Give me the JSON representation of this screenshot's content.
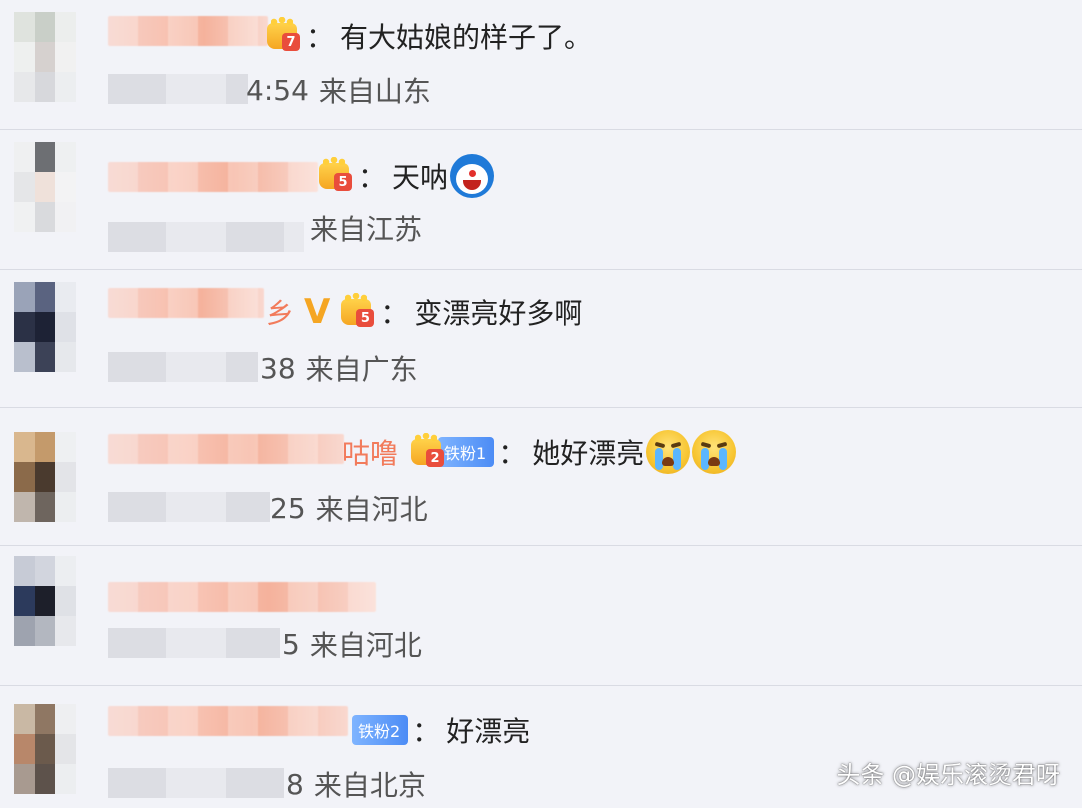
{
  "comments": [
    {
      "name_tail": "",
      "badges": [
        "level-7"
      ],
      "text": "有大姑娘的样子了。",
      "time_tail": "4:54",
      "location": "来自山东",
      "emojis": []
    },
    {
      "name_tail": "",
      "badges": [
        "level-5"
      ],
      "text": "天呐",
      "time_tail": "",
      "location": "来自江苏",
      "emojis": [
        "doraemon-shocked"
      ]
    },
    {
      "name_tail": "乡",
      "badges": [
        "v-verified",
        "level-5"
      ],
      "text": "变漂亮好多啊",
      "time_tail": "38",
      "location": "来自广东",
      "emojis": []
    },
    {
      "name_tail": "咕噜",
      "badges": [
        "level-2",
        "fan-1"
      ],
      "fan_label": "铁粉1",
      "text": "她好漂亮",
      "time_tail": "25",
      "location": "来自河北",
      "emojis": [
        "crying-face",
        "crying-face"
      ]
    },
    {
      "name_tail": "",
      "badges": [],
      "text": "",
      "time_tail": "5",
      "location": "来自河北",
      "emojis": []
    },
    {
      "name_tail": "",
      "badges": [
        "fan-2"
      ],
      "fan_label": "铁粉2",
      "text": "好漂亮",
      "time_tail": "8",
      "location": "来自北京",
      "emojis": []
    }
  ],
  "badge_levels": {
    "c1": "7",
    "c2": "5",
    "c3": "5",
    "c4": "2"
  },
  "v_mark": "V",
  "colon": "：",
  "watermark": "头条 @娱乐滚烫君呀",
  "colors": {
    "background": "#f2f3f8",
    "divider": "#d9dbe3",
    "name_accent": "#f27b5b",
    "fan_badge": "#4c8cf5"
  }
}
